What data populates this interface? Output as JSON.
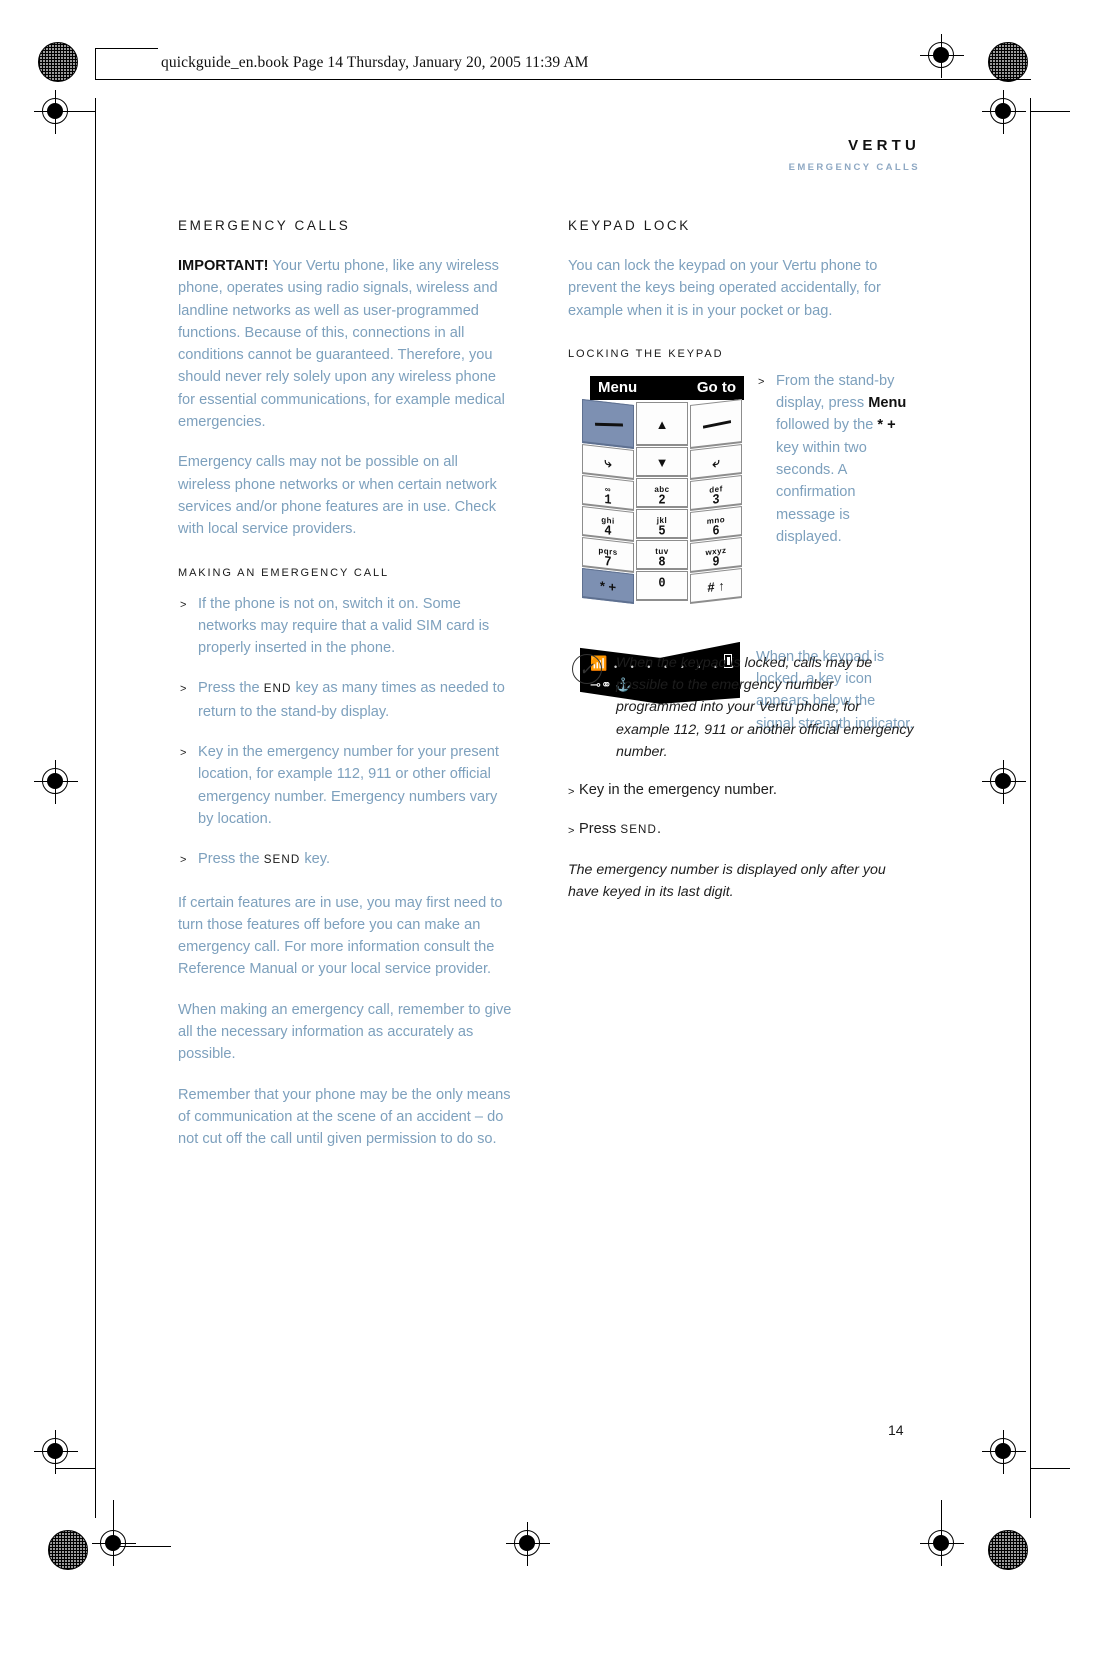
{
  "file_info": {
    "text": "quickguide_en.book  Page 14  Thursday, January 20, 2005  11:39 AM"
  },
  "header": {
    "brand": "VERTU",
    "running_head": "EMERGENCY CALLS"
  },
  "page_number": "14",
  "left_column": {
    "heading": "EMERGENCY CALLS",
    "important_label": "IMPORTANT!",
    "important_body": " Your Vertu phone, like any wireless phone, operates using radio signals, wireless and landline networks as well as user-programmed functions. Because of this, connections in all conditions cannot be guaranteed. Therefore, you should never rely solely upon any wireless phone for essential communications, for example medical emergencies.",
    "paragraph_2": "Emergency calls may not be possible on all wireless phone networks or when certain network services and/or phone features are in use. Check with local service providers.",
    "subheading": "MAKING AN EMERGENCY CALL",
    "steps": [
      {
        "before": "If the phone is not on, switch it on. Some networks may require that a valid SIM card is properly inserted in the phone.",
        "key": "",
        "after": ""
      },
      {
        "before": "Press the ",
        "key": "END",
        "after": " key as many times as needed to return to the stand-by display."
      },
      {
        "before": "Key in the emergency number for your present location, for example 112, 911 or other official emergency number. Emergency numbers vary by location.",
        "key": "",
        "after": ""
      },
      {
        "before": "Press the ",
        "key": "SEND",
        "after": " key."
      }
    ],
    "paragraph_3": "If certain features are in use, you may first need to turn those features off before you can make an emergency call. For more information consult the Reference Manual or your local service provider.",
    "paragraph_4": "When making an emergency call, remember to give all the necessary information as accurately as possible.",
    "paragraph_5": "Remember that your phone may be the only means of communication at the scene of an accident – do not cut off the call until given permission to do so."
  },
  "right_column": {
    "heading": "KEYPAD LOCK",
    "intro": "You can lock the keypad on your Vertu phone to prevent the keys being operated accidentally, for example when it is in your pocket or bag.",
    "subheading": "LOCKING THE KEYPAD",
    "figure": {
      "softkey_left": "Menu",
      "softkey_right": "Go to",
      "keys": [
        {
          "letters": "",
          "digit": "",
          "glyph": "dash",
          "name": "left-softkey"
        },
        {
          "letters": "",
          "digit": "",
          "glyph": "⌃",
          "name": "navi-up-key"
        },
        {
          "letters": "",
          "digit": "",
          "glyph": "dash",
          "name": "right-softkey"
        },
        {
          "letters": "",
          "digit": "",
          "glyph": "⤷",
          "name": "send-key"
        },
        {
          "letters": "",
          "digit": "",
          "glyph": "⌄",
          "name": "navi-down-key"
        },
        {
          "letters": "",
          "digit": "",
          "glyph": "⤶",
          "name": "end-key"
        },
        {
          "letters": "∞",
          "digit": "1",
          "glyph": "",
          "name": "key-1"
        },
        {
          "letters": "abc",
          "digit": "2",
          "glyph": "",
          "name": "key-2"
        },
        {
          "letters": "def",
          "digit": "3",
          "glyph": "",
          "name": "key-3"
        },
        {
          "letters": "ghi",
          "digit": "4",
          "glyph": "",
          "name": "key-4"
        },
        {
          "letters": "jkl",
          "digit": "5",
          "glyph": "",
          "name": "key-5"
        },
        {
          "letters": "mno",
          "digit": "6",
          "glyph": "",
          "name": "key-6"
        },
        {
          "letters": "pqrs",
          "digit": "7",
          "glyph": "",
          "name": "key-7"
        },
        {
          "letters": "tuv",
          "digit": "8",
          "glyph": "",
          "name": "key-8"
        },
        {
          "letters": "wxyz",
          "digit": "9",
          "glyph": "",
          "name": "key-9"
        },
        {
          "letters": "",
          "digit": "",
          "glyph": "* +",
          "name": "star-key"
        },
        {
          "letters": "",
          "digit": "0",
          "glyph": "",
          "name": "key-0"
        },
        {
          "letters": "",
          "digit": "",
          "glyph": "# ↑",
          "name": "hash-key"
        }
      ],
      "caption_step": {
        "before": "From the stand-by display, press ",
        "bold": "Menu",
        "middle": " followed by the ",
        "bold2": "* +",
        "after": " key within two seconds. A confirmation message is displayed."
      },
      "caption_display": "When the keypad is locked, a key icon appears below the signal strength indicator.",
      "display_dots": "• • • • • • • • • •"
    },
    "note": "When the keypad is locked, calls may be possible to the emergency number programmed into your Vertu phone, for example 112, 911 or another official emergency number.",
    "note_steps": [
      {
        "before": "Key in the emergency number.",
        "key": "",
        "after": ""
      },
      {
        "before": "Press ",
        "key": "SEND",
        "after": "."
      }
    ],
    "closing_note": "The emergency number is displayed only after you have keyed in its last digit."
  },
  "colors": {
    "body_blue": "#7da0bd",
    "heading_dark": "#1a1a1a",
    "running_head": "#8ea8c3",
    "key_blue": "#7d90b2"
  }
}
